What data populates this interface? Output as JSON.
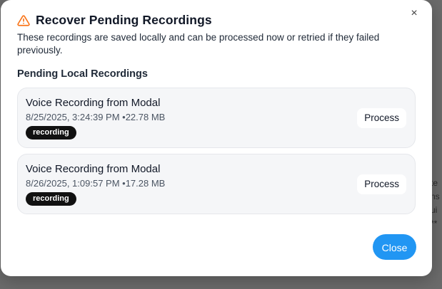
{
  "background": {
    "side_text": [
      "te",
      "ns",
      "ui",
      "**"
    ]
  },
  "modal": {
    "title": "Recover Pending Recordings",
    "title_icon": "warning-triangle-icon",
    "accent_color": "#f97316",
    "close_glyph": "×",
    "description": "These recordings are saved locally and can be processed now or retried if they failed previously.",
    "section_title": "Pending Local Recordings",
    "recordings": [
      {
        "name": "Voice Recording from Modal",
        "meta": "8/25/2025, 3:24:39 PM •22.78 MB",
        "status": "recording",
        "action_label": "Process"
      },
      {
        "name": "Voice Recording from Modal",
        "meta": "8/26/2025, 1:09:57 PM •17.28 MB",
        "status": "recording",
        "action_label": "Process"
      }
    ],
    "footer": {
      "close_label": "Close",
      "close_color": "#2196f3"
    }
  }
}
